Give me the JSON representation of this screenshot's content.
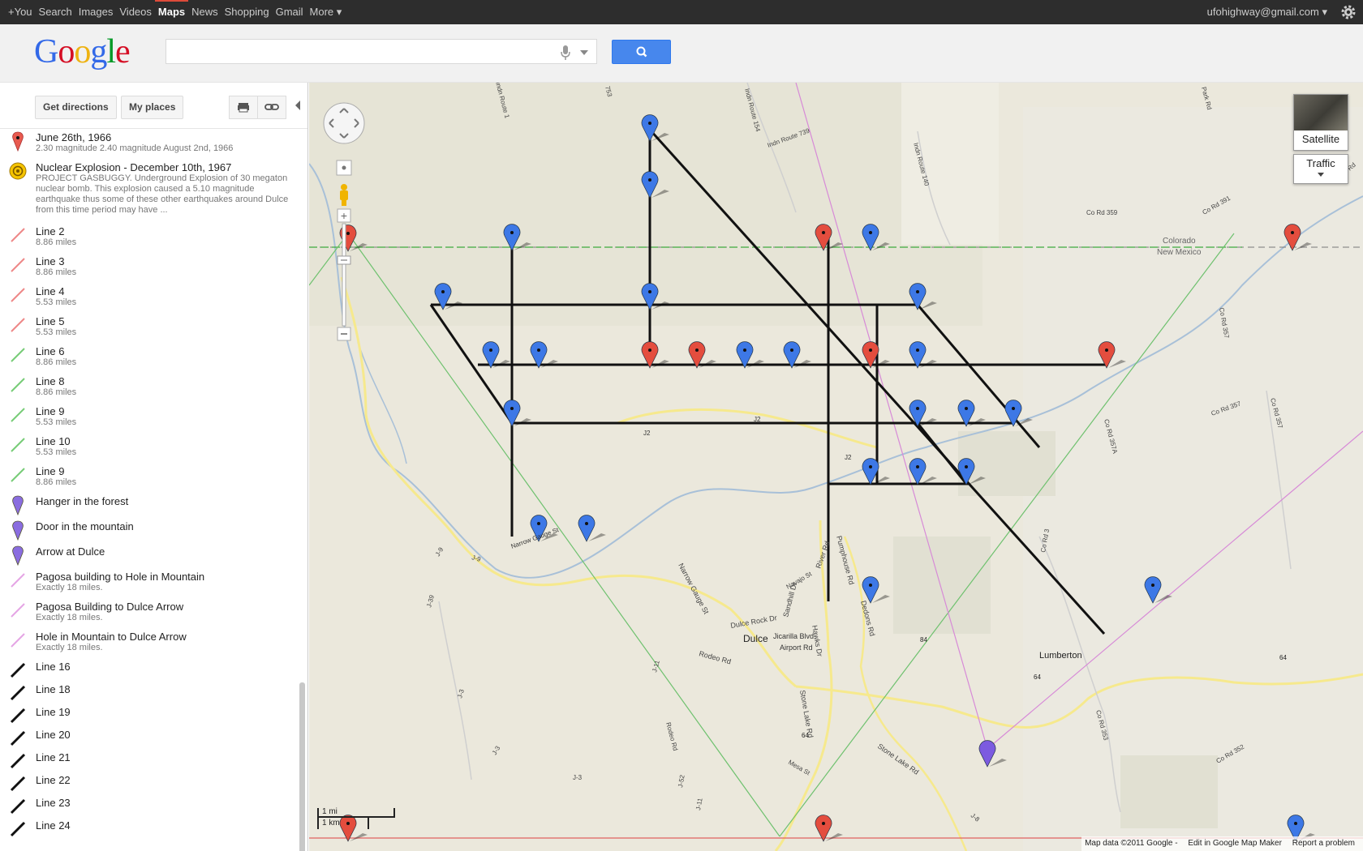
{
  "topbar": {
    "nav": [
      "+You",
      "Search",
      "Images",
      "Videos",
      "Maps",
      "News",
      "Shopping",
      "Gmail",
      "More ▾"
    ],
    "active": "Maps",
    "account": "ufohighway@gmail.com ▾"
  },
  "logo": "Google",
  "search": {
    "value": "",
    "placeholder": ""
  },
  "toolbar": {
    "directions": "Get directions",
    "places": "My places"
  },
  "list": [
    {
      "title": "June 26th, 1966",
      "sub": "2.30 magnitude 2.40 magnitude August 2nd, 1966",
      "icon": "red-pin"
    },
    {
      "title": "Nuclear Explosion - December 10th, 1967",
      "sub": "PROJECT GASBUGGY. Underground Explosion of 30 megaton nuclear bomb. This explosion caused a 5.10 magnitude earthquake thus some of these other earthquakes around Dulce from this time period may have ...",
      "icon": "sun-icon"
    },
    {
      "title": "Line 2",
      "sub": "8.86 miles",
      "icon": "red-line"
    },
    {
      "title": "Line 3",
      "sub": "8.86 miles",
      "icon": "red-line"
    },
    {
      "title": "Line 4",
      "sub": "5.53 miles",
      "icon": "red-line"
    },
    {
      "title": "Line 5",
      "sub": "5.53 miles",
      "icon": "red-line"
    },
    {
      "title": "Line 6",
      "sub": "8.86 miles",
      "icon": "green-line"
    },
    {
      "title": "Line 8",
      "sub": "8.86 miles",
      "icon": "green-line"
    },
    {
      "title": "Line 9",
      "sub": "5.53 miles",
      "icon": "green-line"
    },
    {
      "title": "Line 10",
      "sub": "5.53 miles",
      "icon": "green-line"
    },
    {
      "title": "Line 9",
      "sub": "8.86 miles",
      "icon": "green-line"
    },
    {
      "title": "Hanger in the forest",
      "sub": "",
      "icon": "purple-pin"
    },
    {
      "title": "Door in the mountain",
      "sub": "",
      "icon": "purple-pin"
    },
    {
      "title": "Arrow at Dulce",
      "sub": "",
      "icon": "purple-pin"
    },
    {
      "title": "Pagosa building to Hole in Mountain",
      "sub": "Exactly 18 miles.",
      "icon": "pink-line"
    },
    {
      "title": "Pagosa Building to Dulce Arrow",
      "sub": "Exactly 18 miles.",
      "icon": "pink-line"
    },
    {
      "title": "Hole in Mountain to Dulce Arrow",
      "sub": "Exactly 18 miles.",
      "icon": "pink-line"
    },
    {
      "title": "Line 16",
      "sub": "",
      "icon": "black-line"
    },
    {
      "title": "Line 18",
      "sub": "",
      "icon": "black-line"
    },
    {
      "title": "Line 19",
      "sub": "",
      "icon": "black-line"
    },
    {
      "title": "Line 20",
      "sub": "",
      "icon": "black-line"
    },
    {
      "title": "Line 21",
      "sub": "",
      "icon": "black-line"
    },
    {
      "title": "Line 22",
      "sub": "",
      "icon": "black-line"
    },
    {
      "title": "Line 23",
      "sub": "",
      "icon": "black-line"
    },
    {
      "title": "Line 24",
      "sub": "",
      "icon": "black-line"
    }
  ],
  "map_controls": {
    "satellite": "Satellite",
    "traffic": "Traffic"
  },
  "scale": {
    "mi": "1 mi",
    "km": "1 km"
  },
  "map_labels": {
    "dulce": "Dulce",
    "lumberton": "Lumberton",
    "colorado": "Colorado",
    "new_mexico": "New Mexico",
    "jicarilla": "Jicarilla Blvd",
    "airport": "Airport Rd",
    "rodeo": "Rodeo Rd",
    "rodeo2": "Rodeo Rd",
    "narrow_gauge": "Narrow Gauge St",
    "narrow_gauge2": "Narrow Gauge St",
    "stone_lake": "Stone Lake Rd",
    "stone_lake2": "Stone Lake Rd",
    "mesa": "Mesa St",
    "dulce_rock": "Dulce Rock Dr",
    "sandhill": "Sandhill Dr",
    "hawks": "Hawks Dr",
    "river": "River Rd",
    "pumphouse": "Pumphouse Rd",
    "dedons": "Dedons Rd",
    "navajo": "Navajo St",
    "j2a": "J2",
    "j2b": "J2",
    "j2c": "J2",
    "j9a": "J-9",
    "j9b": "J-9",
    "j39": "J-39",
    "j3a": "J-3",
    "j3b": "J-3",
    "j3c": "J-3",
    "j11": "J-11",
    "j52": "J-52",
    "j11b": "J-11",
    "j8": "J-8",
    "indn739": "Indn Route 739",
    "indn140": "Indn Route 140",
    "indn154": "Indn Route 154",
    "r753": "753",
    "indn_route": "Indn Route 1",
    "co359": "Co Rd 359",
    "co391": "Co Rd 391",
    "co357": "Co Rd 357",
    "co357b": "Co Rd 357",
    "co357c": "Co Rd 357",
    "co357a": "Co Rd 357A",
    "co353": "Co Rd 353",
    "co352": "Co Rd 352",
    "co3": "Co Rd 3",
    "park": "Park Rd",
    "edith": "Edith Rd",
    "h64a": "64",
    "h64b": "64",
    "h64c": "64",
    "h84": "84"
  },
  "attribution": [
    "Map data ©2011 Google -",
    "Edit in Google Map Maker",
    "Report a problem"
  ]
}
